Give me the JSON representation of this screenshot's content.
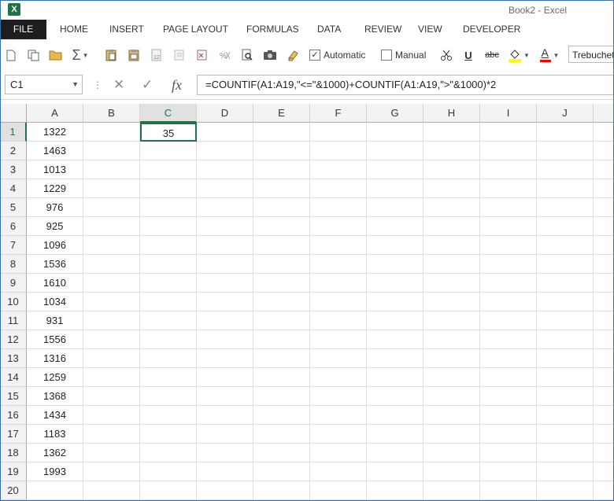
{
  "window": {
    "app_icon": "X",
    "title": "Book2 - Excel"
  },
  "tabs": [
    "FILE",
    "HOME",
    "INSERT",
    "PAGE LAYOUT",
    "FORMULAS",
    "DATA",
    "REVIEW",
    "VIEW",
    "DEVELOPER"
  ],
  "toolbar": {
    "automatic_label": "Automatic",
    "manual_label": "Manual",
    "automatic_checked": true,
    "manual_checked": false,
    "underline_glyph": "U",
    "strike_glyph": "abc",
    "sum_glyph": "Σ",
    "font_color_glyph": "A",
    "font_name": "Trebuchet",
    "fill_color": "#ffff00",
    "font_color": "#ff0000"
  },
  "formula_bar": {
    "name_box": "C1",
    "cancel_glyph": "✕",
    "enter_glyph": "✓",
    "fx_glyph": "fx",
    "formula": "=COUNTIF(A1:A19,\"<=\"&1000)+COUNTIF(A1:A19,\">\"&1000)*2"
  },
  "grid": {
    "columns": [
      "A",
      "B",
      "C",
      "D",
      "E",
      "F",
      "G",
      "H",
      "I",
      "J"
    ],
    "rows": [
      "1",
      "2",
      "3",
      "4",
      "5",
      "6",
      "7",
      "8",
      "9",
      "10",
      "11",
      "12",
      "13",
      "14",
      "15",
      "16",
      "17",
      "18",
      "19",
      "20"
    ],
    "column_a": [
      "1322",
      "1463",
      "1013",
      "1229",
      "976",
      "925",
      "1096",
      "1536",
      "1610",
      "1034",
      "931",
      "1556",
      "1316",
      "1259",
      "1368",
      "1434",
      "1183",
      "1362",
      "1993",
      ""
    ],
    "c1": "35",
    "selected_cell": "C1",
    "accent_color": "#217346"
  }
}
